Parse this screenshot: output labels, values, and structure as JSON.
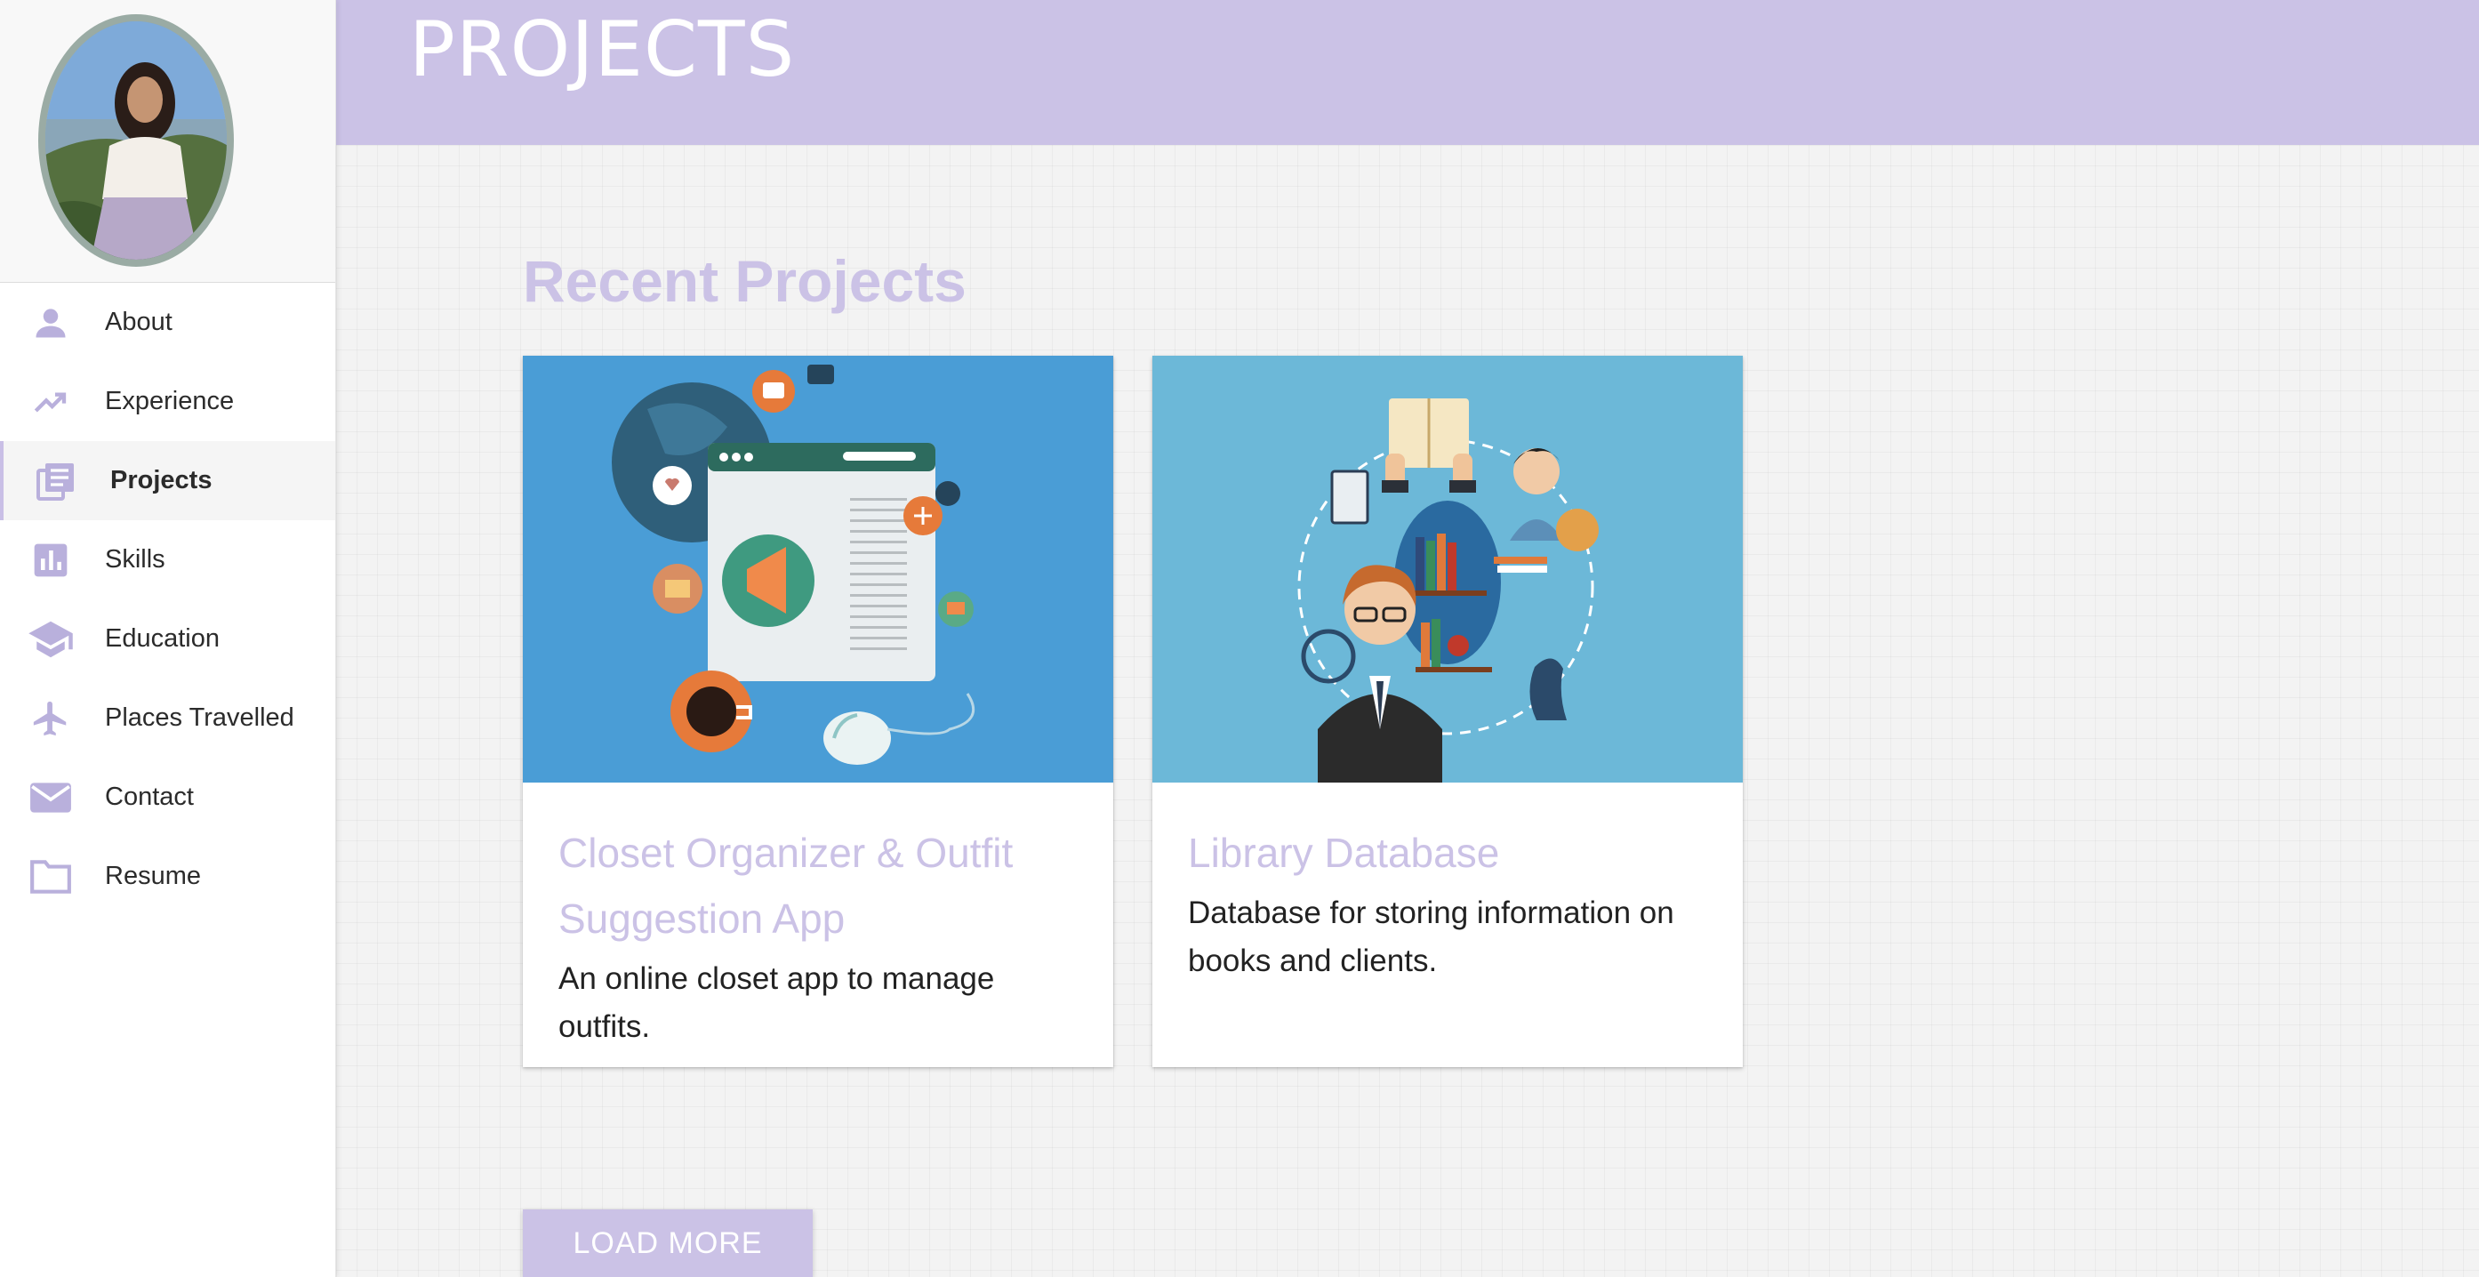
{
  "header": {
    "title": "PROJECTS"
  },
  "sidebar": {
    "items": [
      {
        "label": "About",
        "icon": "person-icon"
      },
      {
        "label": "Experience",
        "icon": "trending-up-icon"
      },
      {
        "label": "Projects",
        "icon": "library-books-icon",
        "active": true
      },
      {
        "label": "Skills",
        "icon": "bar-chart-icon"
      },
      {
        "label": "Education",
        "icon": "graduation-cap-icon"
      },
      {
        "label": "Places Travelled",
        "icon": "airplane-icon"
      },
      {
        "label": "Contact",
        "icon": "mail-icon"
      },
      {
        "label": "Resume",
        "icon": "folder-icon"
      }
    ]
  },
  "main": {
    "section_title": "Recent Projects",
    "projects": [
      {
        "title": "Closet Organizer & Outfit Suggestion App",
        "description": "An online closet app to manage outfits."
      },
      {
        "title": "Library Database",
        "description": "Database for storing information on books and clients."
      }
    ],
    "load_more_label": "LOAD MORE"
  },
  "colors": {
    "accent": "#cbc2e6",
    "card1_bg": "#4a9dd6",
    "card2_bg": "#6cb8d8"
  }
}
